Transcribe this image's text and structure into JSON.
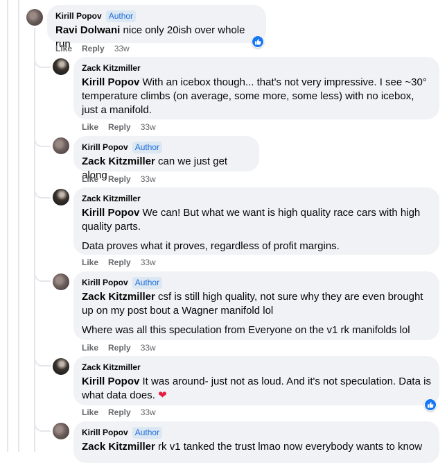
{
  "colors": {
    "author_badge_bg": "#dbe7f2",
    "author_badge_text": "#216fdb",
    "bubble": "#f0f2f5",
    "like_blue": "#1877f2",
    "heart": "#e41e3f"
  },
  "action_labels": {
    "like": "Like",
    "reply": "Reply"
  },
  "comments": [
    {
      "author": "Kirill Popov",
      "badge": "Author",
      "mention": "Ravi Dolwani",
      "text": " nice only 20ish over whole run",
      "time": "33w",
      "reaction": "like-icon"
    },
    {
      "author": "Zack Kitzmiller",
      "mention": "Kirill Popov",
      "text": " With an icebox though... that's not very impressive. I see ~30° temperature climbs (on average, some more, some less) with no icebox, just a manifold.",
      "time": "33w"
    },
    {
      "author": "Kirill Popov",
      "badge": "Author",
      "mention": "Zack Kitzmiller",
      "text": " can we just get along",
      "time": "33w"
    },
    {
      "author": "Zack Kitzmiller",
      "mention": "Kirill Popov",
      "text": " We can! But what we want is high quality race cars with high quality parts.",
      "text2": "Data proves what it proves, regardless of profit margins.",
      "time": "33w"
    },
    {
      "author": "Kirill Popov",
      "badge": "Author",
      "mention": "Zack Kitzmiller",
      "text": " csf is still high quality, not sure why they are even brought up on my post bout a Wagner manifold lol",
      "text2": "Where was all this speculation from Everyone on the v1 rk manifolds lol",
      "time": "33w"
    },
    {
      "author": "Zack Kitzmiller",
      "mention": "Kirill Popov",
      "text": " It was around- just not as loud. And it's not speculation. Data is what data does.",
      "time": "33w",
      "reaction": "like-icon",
      "emoji": "heart"
    },
    {
      "author": "Kirill Popov",
      "badge": "Author",
      "mention": "Zack Kitzmiller",
      "text": " rk v1 tanked the trust lmao now everybody wants to know"
    }
  ]
}
